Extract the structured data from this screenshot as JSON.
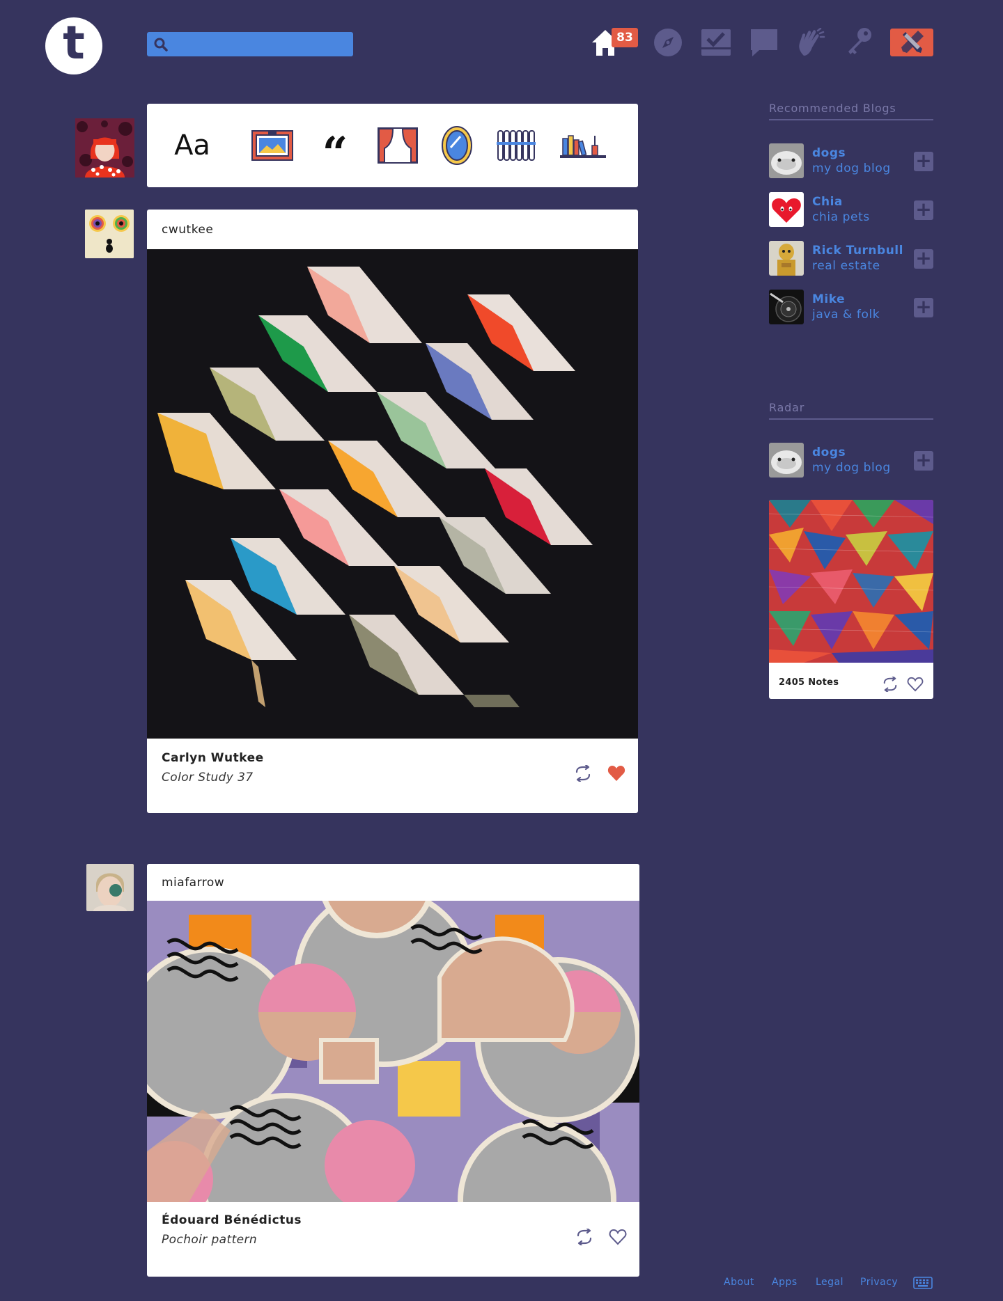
{
  "header": {
    "logo_letter": "t",
    "search_placeholder": "",
    "inbox_count": "83"
  },
  "composer": {
    "types": [
      "text",
      "photo",
      "quote",
      "link",
      "chat",
      "audio",
      "video"
    ],
    "text_label": "Aa",
    "quote_label": "“"
  },
  "posts": [
    {
      "username": "cwutkee",
      "artist": "Carlyn Wutkee",
      "title": "Color Study 37",
      "liked": true
    },
    {
      "username": "miafarrow",
      "artist": "Édouard Bénédictus",
      "title": "Pochoir pattern",
      "liked": false
    }
  ],
  "sidebar": {
    "recommended_title": "Recommended Blogs",
    "recommended": [
      {
        "name": "dogs",
        "desc": "my dog blog"
      },
      {
        "name": "Chia",
        "desc": "chia pets"
      },
      {
        "name": "Rick Turnbull",
        "desc": "real estate"
      },
      {
        "name": "Mike",
        "desc": "java & folk"
      }
    ],
    "radar_title": "Radar",
    "radar_blog": {
      "name": "dogs",
      "desc": "my dog blog"
    },
    "radar_notes": "2405 Notes"
  },
  "footer": {
    "links": [
      "About",
      "Apps",
      "Legal",
      "Privacy"
    ]
  },
  "colors": {
    "background": "#36345e",
    "accent_blue": "#4a86e0",
    "accent_red": "#e25b45",
    "muted_purple": "#5d5b8c"
  }
}
